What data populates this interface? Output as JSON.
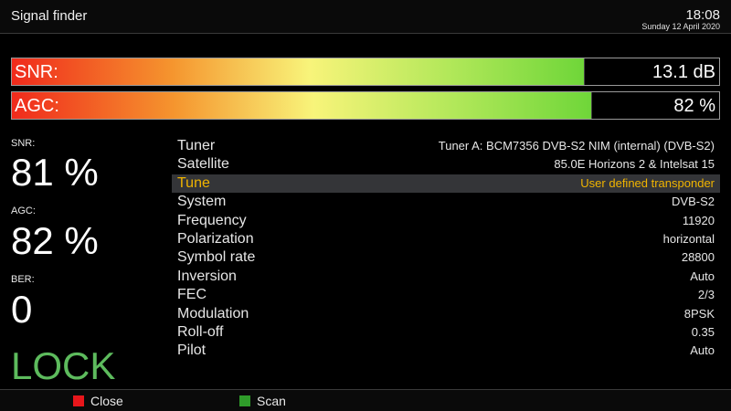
{
  "header": {
    "title": "Signal finder",
    "time": "18:08",
    "date": "Sunday 12 April 2020"
  },
  "meters": {
    "snr": {
      "label": "SNR:",
      "value_text": "13.1 dB",
      "fill_fraction": 0.81
    },
    "agc": {
      "label": "AGC:",
      "value_text": "82 %",
      "fill_fraction": 0.82
    }
  },
  "readouts": {
    "snr_label": "SNR:",
    "snr_value": "81 %",
    "agc_label": "AGC:",
    "agc_value": "82 %",
    "ber_label": "BER:",
    "ber_value": "0",
    "lock_status": "LOCK"
  },
  "info_rows": [
    {
      "key": "Tuner",
      "value": "Tuner A: BCM7356 DVB-S2 NIM (internal) (DVB-S2)"
    },
    {
      "key": "Satellite",
      "value": "85.0E Horizons 2 & Intelsat 15"
    },
    {
      "key": "Tune",
      "value": "User defined transponder",
      "selected": true
    },
    {
      "key": "System",
      "value": "DVB-S2"
    },
    {
      "key": "Frequency",
      "value": "11920"
    },
    {
      "key": "Polarization",
      "value": "horizontal"
    },
    {
      "key": "Symbol rate",
      "value": "28800"
    },
    {
      "key": "Inversion",
      "value": "Auto"
    },
    {
      "key": "FEC",
      "value": "2/3"
    },
    {
      "key": "Modulation",
      "value": "8PSK"
    },
    {
      "key": "Roll-off",
      "value": "0.35"
    },
    {
      "key": "Pilot",
      "value": "Auto"
    }
  ],
  "footer": {
    "close": {
      "label": "Close",
      "color": "#e8161b"
    },
    "scan": {
      "label": "Scan",
      "color": "#2f9c2a"
    }
  },
  "colors": {
    "lock": "#5dbb5d",
    "selected_text": "#f0b400",
    "selected_row_bg": "#343538"
  }
}
